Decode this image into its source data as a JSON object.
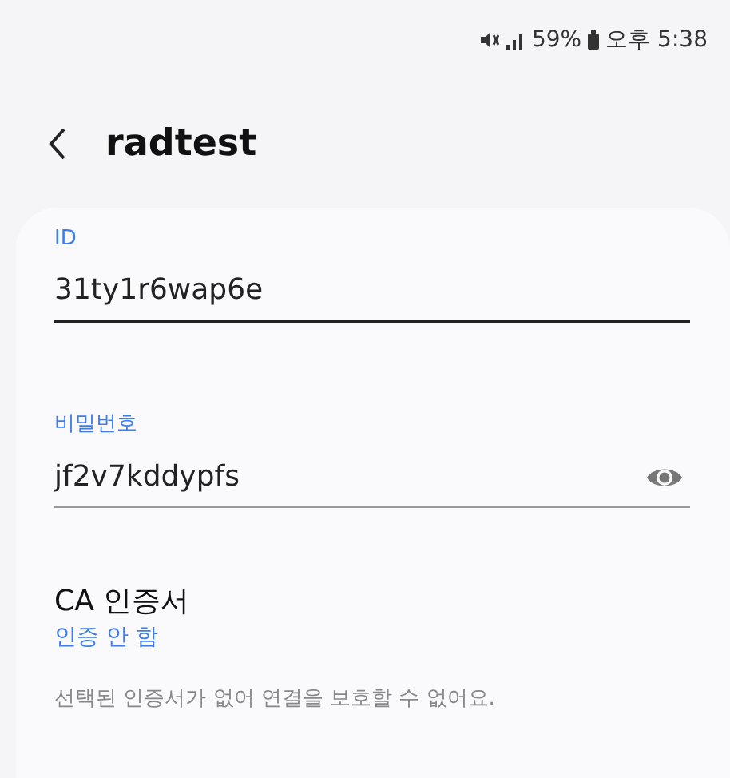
{
  "status_bar": {
    "battery": "59%",
    "time": "오후 5:38"
  },
  "header": {
    "title": "radtest"
  },
  "fields": [
    {
      "kind": "text",
      "label": "ID",
      "value": "31ty1r6wap6e",
      "focused": true
    },
    {
      "kind": "password",
      "label": "비밀번호",
      "value": "jf2v7kddypfs",
      "focused": false
    }
  ],
  "ca_certificate": {
    "title": "CA 인증서",
    "value": "인증 안 함",
    "note": "선택된 인증서가 없어 연결을 보호할 수 없어요."
  }
}
